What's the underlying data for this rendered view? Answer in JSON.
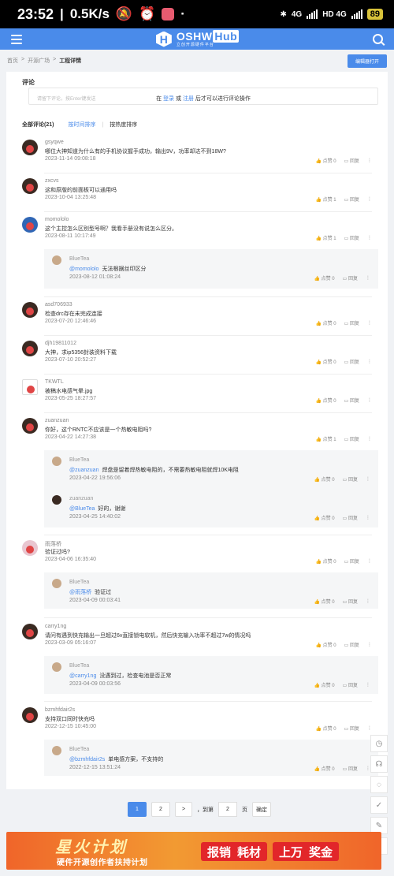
{
  "status": {
    "time": "23:52",
    "speed": "0.5K/s",
    "network1": "4G",
    "network2": "HD 4G",
    "battery": "89"
  },
  "header": {
    "logo_name": "OSHW",
    "logo_hub": "Hub",
    "logo_sub": "立创开源硬件平台"
  },
  "breadcrumb": [
    "首页",
    ">",
    "开源广场",
    ">",
    "工程详情"
  ],
  "edit_button": "编辑器打开",
  "comments_section": {
    "title": "评论",
    "placeholder": "请留下评论，按Enter键发送",
    "login_prefix": "在",
    "login": "登录",
    "or": "或",
    "register": "注册",
    "login_suffix": "后才可以进行评论操作",
    "total": "全部评论(21)",
    "sort_time": "按时间排序",
    "sep": "|",
    "sort_hot": "按热度排序"
  },
  "labels": {
    "like": "点赞",
    "reply": "回复",
    "more": "⋮"
  },
  "comments": [
    {
      "name": "gsyqwe",
      "text": "哪位大神知道为什么有的手机协议握手成功，输出9V，功率却达不到18W?",
      "time": "2023-11-14 09:08:18",
      "likes": "0"
    },
    {
      "name": "zxcvs",
      "text": "这和原版的前面板可以通用吗",
      "time": "2023-10-04 13:25:48",
      "likes": "1"
    },
    {
      "name": "momololo",
      "text": "这个主控怎么区别型号啊？我看手册没有说怎么区分。",
      "time": "2023-08-11 10:17:49",
      "likes": "1"
    },
    {
      "name": "asd706933",
      "text": "检查drc存在未完成连接",
      "time": "2023-07-20 12:46:46",
      "likes": "0"
    },
    {
      "name": "djh19811012",
      "text": "大神，求ip5356封装资料下载",
      "time": "2023-07-10 20:52:27",
      "likes": "0"
    },
    {
      "name": "TKWTL",
      "text": "被稿水电感气晕.jpg",
      "time": "2023-05-25 18:27:57",
      "likes": "0"
    },
    {
      "name": "zuanzuan",
      "text": "你好，这个RNTC不应该是一个热敏电阻吗?",
      "time": "2023-04-22 14:27:38",
      "likes": "1"
    },
    {
      "name": "雨落桥",
      "text": "验证过吗?",
      "time": "2023-04-06 16:35:40",
      "likes": "0"
    },
    {
      "name": "carry1ng",
      "text": "请问有遇到快充输出一旦超过6v直接锁电软机，然后快充输入功率不超过7w的情况吗",
      "time": "2023-03-09 05:16:07",
      "likes": "0"
    },
    {
      "name": "bzmhfdair2s",
      "text": "支持双口同时快充吗",
      "time": "2022-12-15 10:45:00",
      "likes": "0"
    }
  ],
  "replies": [
    {
      "name": "BlueTea",
      "at": "@momololo",
      "text": "无法根据丝印区分",
      "time": "2023-08-12 01:08:24",
      "likes": "0"
    },
    {
      "name": "BlueTea",
      "at": "@zuanzuan",
      "text": "焊盘是留着焊热敏电阻的，不需要热敏电阻就焊10K电阻",
      "time": "2023-04-22 19:56:06",
      "likes": "0"
    },
    {
      "name": "zuanzuan",
      "at": "@BlueTea",
      "text": "好的，谢谢",
      "time": "2023-04-25 14:40:02",
      "likes": "0"
    },
    {
      "name": "BlueTea",
      "at": "@雨落桥",
      "text": "验证过",
      "time": "2023-04-09 00:03:41",
      "likes": "0"
    },
    {
      "name": "BlueTea",
      "at": "@carry1ng",
      "text": "没遇到过，检查电池是否正常",
      "time": "2023-04-09 00:03:56",
      "likes": "0"
    },
    {
      "name": "BlueTea",
      "at": "@bzmhfdair2s",
      "text": "单电感方案，不支持的",
      "time": "2022-12-15 13:51:24",
      "likes": "0"
    }
  ],
  "pagination": {
    "page1": "1",
    "page2": "2",
    "next": ">",
    "goto_prefix": "，到第",
    "goto_value": "2",
    "goto_suffix": "页",
    "confirm": "确定"
  },
  "banner": {
    "title": "星火计划",
    "subtitle": "硬件开源创作者扶持计划",
    "pill1_a": "报销",
    "pill1_b": "耗材",
    "pill2_a": "上万",
    "pill2_b": "奖金"
  },
  "colors": {
    "accent": "#4a8bea",
    "banner": "#f0652a"
  }
}
